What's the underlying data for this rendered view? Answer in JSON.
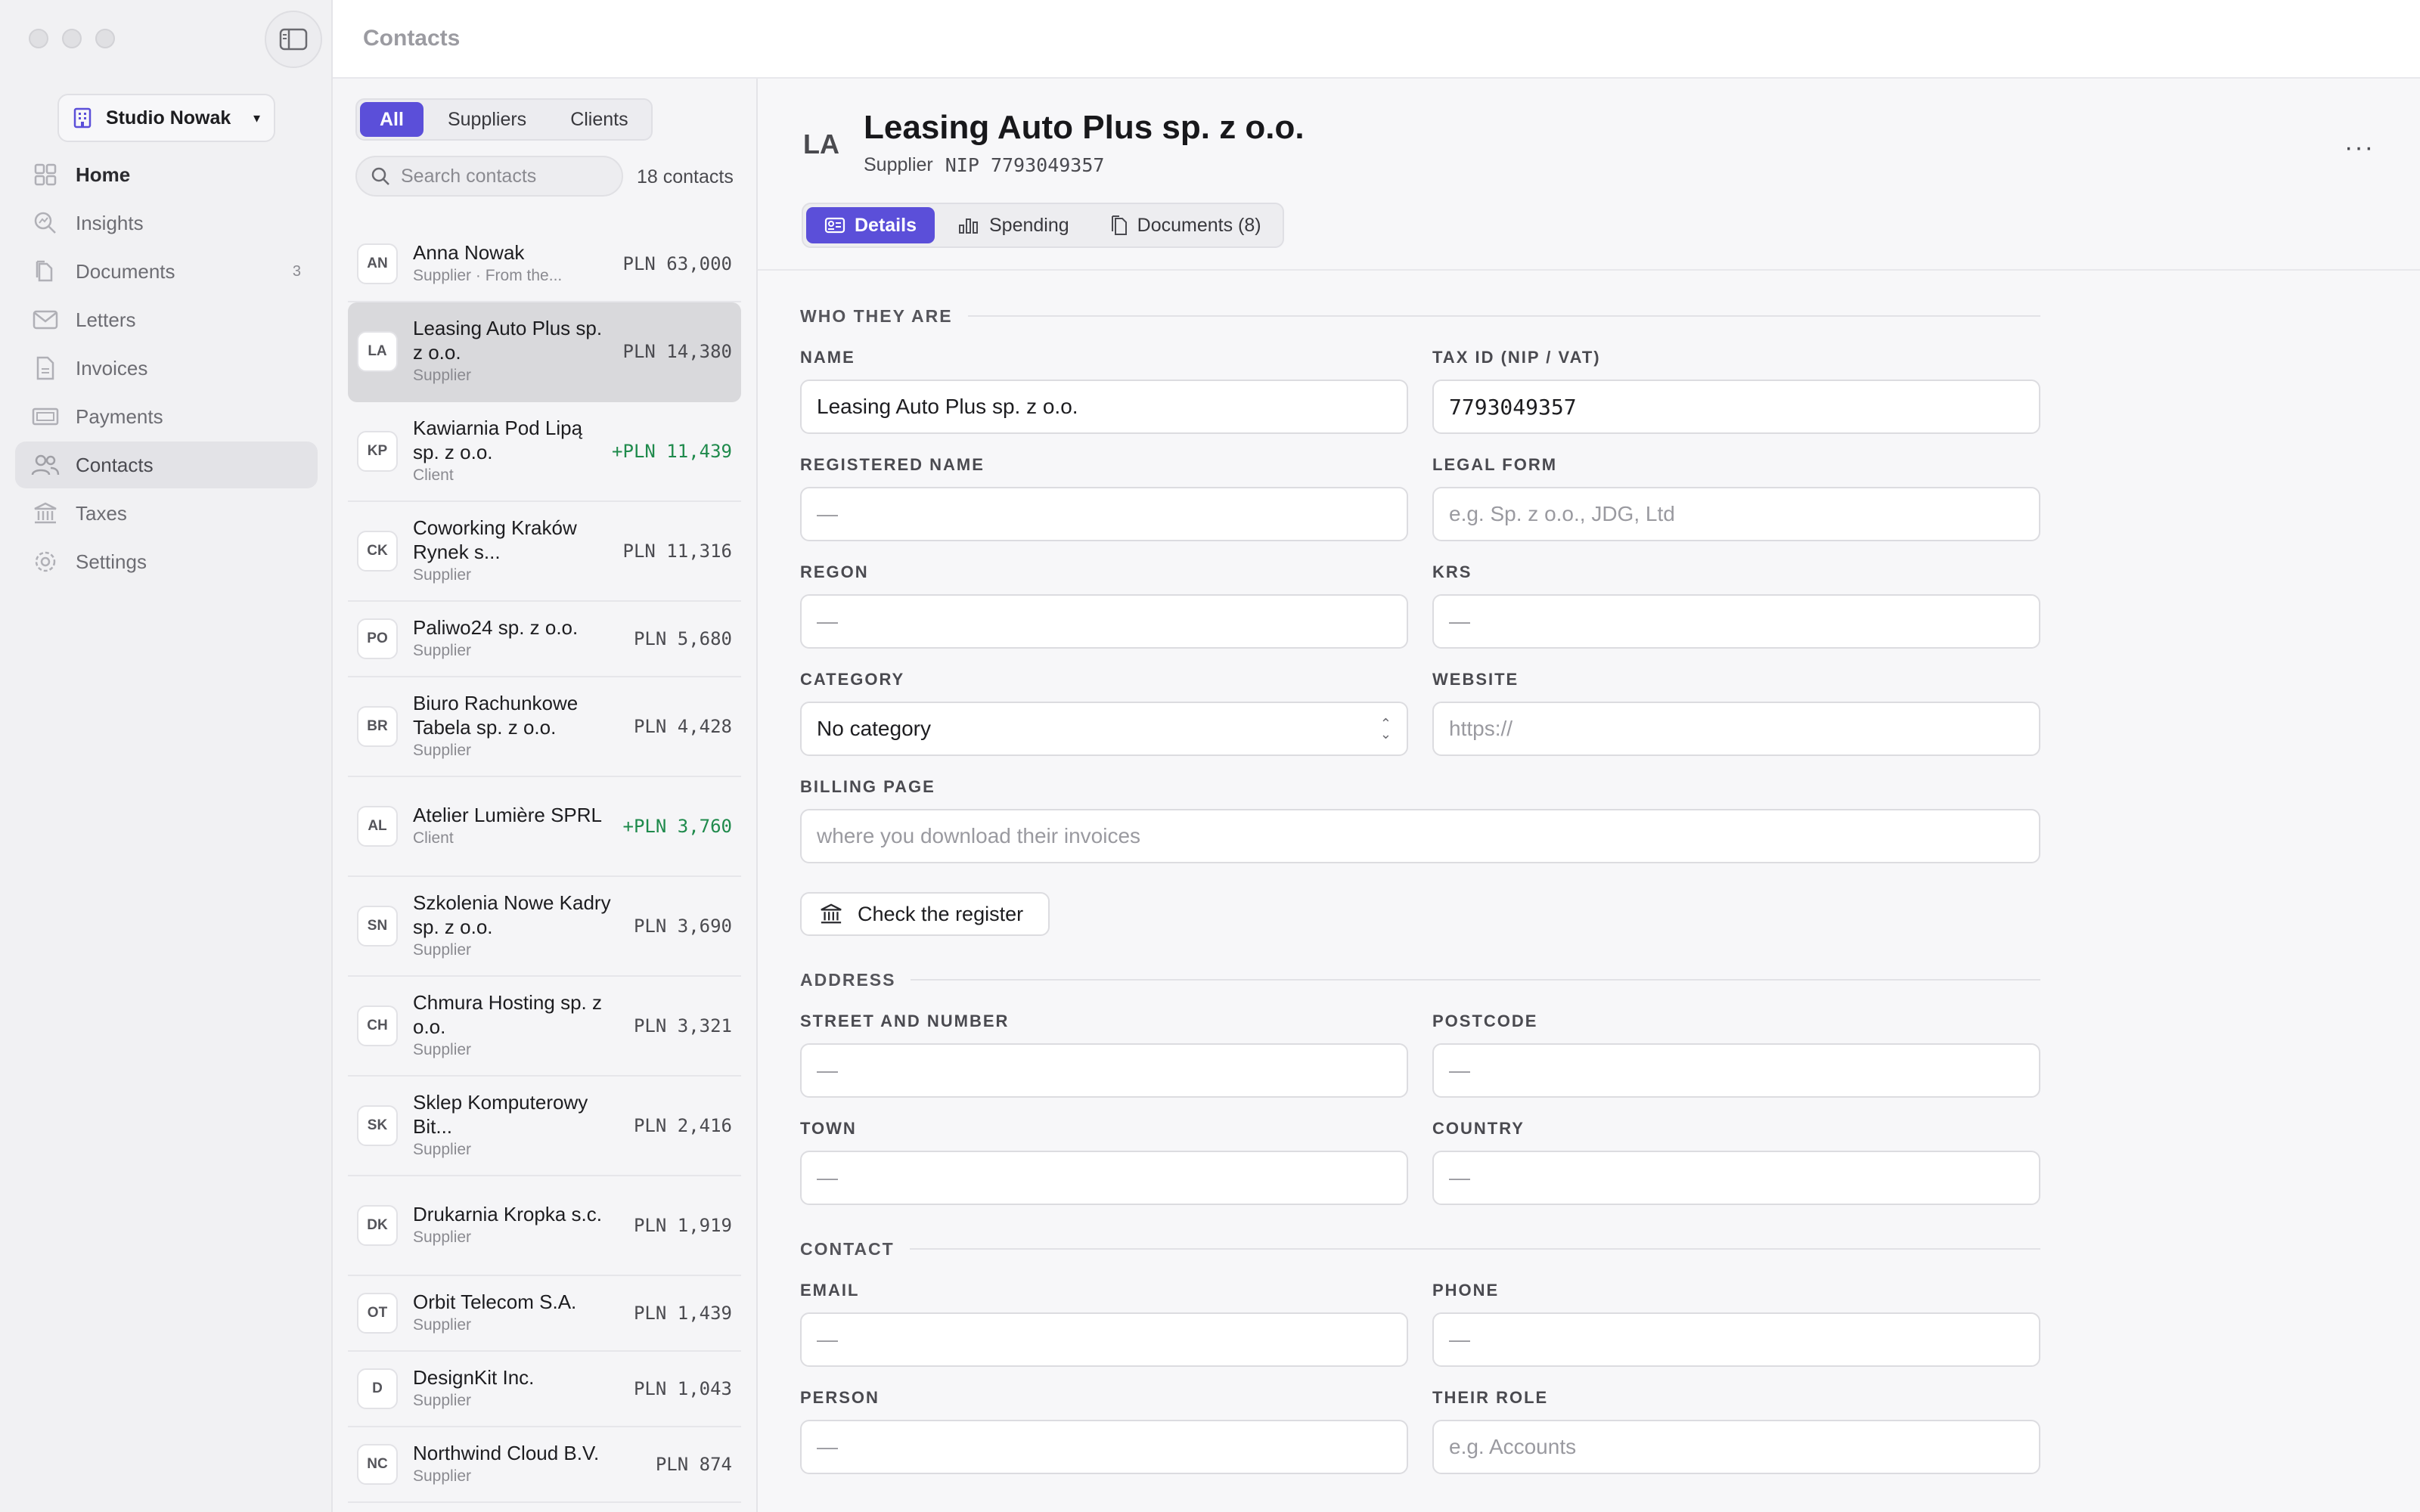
{
  "window": {
    "title": "Contacts"
  },
  "org": {
    "name": "Studio Nowak"
  },
  "nav": [
    {
      "id": "home",
      "label": "Home",
      "icon": "grid-icon"
    },
    {
      "id": "insights",
      "label": "Insights",
      "icon": "insights-icon"
    },
    {
      "id": "documents",
      "label": "Documents",
      "icon": "documents-icon",
      "badge": "3"
    },
    {
      "id": "letters",
      "label": "Letters",
      "icon": "envelope-icon"
    },
    {
      "id": "invoices",
      "label": "Invoices",
      "icon": "invoice-icon"
    },
    {
      "id": "payments",
      "label": "Payments",
      "icon": "payments-icon"
    },
    {
      "id": "contacts",
      "label": "Contacts",
      "icon": "people-icon"
    },
    {
      "id": "taxes",
      "label": "Taxes",
      "icon": "bank-icon"
    },
    {
      "id": "settings",
      "label": "Settings",
      "icon": "gear-icon"
    }
  ],
  "list": {
    "filters": [
      "All",
      "Suppliers",
      "Clients"
    ],
    "search_placeholder": "Search contacts",
    "count": "18 contacts",
    "contacts": [
      {
        "initials": "AN",
        "name": "Anna Nowak",
        "sub": "Supplier · From the...",
        "amount": "PLN 63,000"
      },
      {
        "initials": "LA",
        "name": "Leasing Auto Plus sp. z o.o.",
        "sub": "Supplier",
        "amount": "PLN 14,380"
      },
      {
        "initials": "KP",
        "name": "Kawiarnia Pod Lipą sp. z o.o.",
        "sub": "Client",
        "amount": "+PLN 11,439"
      },
      {
        "initials": "CK",
        "name": "Coworking Kraków Rynek s...",
        "sub": "Supplier",
        "amount": "PLN 11,316"
      },
      {
        "initials": "PO",
        "name": "Paliwo24 sp. z o.o.",
        "sub": "Supplier",
        "amount": "PLN 5,680"
      },
      {
        "initials": "BR",
        "name": "Biuro Rachunkowe Tabela sp. z o.o.",
        "sub": "Supplier",
        "amount": "PLN 4,428"
      },
      {
        "initials": "AL",
        "name": "Atelier Lumière SPRL",
        "sub": "Client",
        "amount": "+PLN 3,760"
      },
      {
        "initials": "SN",
        "name": "Szkolenia Nowe Kadry sp. z o.o.",
        "sub": "Supplier",
        "amount": "PLN 3,690"
      },
      {
        "initials": "CH",
        "name": "Chmura Hosting sp. z o.o.",
        "sub": "Supplier",
        "amount": "PLN 3,321"
      },
      {
        "initials": "SK",
        "name": "Sklep Komputerowy Bit...",
        "sub": "Supplier",
        "amount": "PLN 2,416"
      },
      {
        "initials": "DK",
        "name": "Drukarnia Kropka s.c.",
        "sub": "Supplier",
        "amount": "PLN 1,919"
      },
      {
        "initials": "OT",
        "name": "Orbit Telecom S.A.",
        "sub": "Supplier",
        "amount": "PLN 1,439"
      },
      {
        "initials": "D",
        "name": "DesignKit Inc.",
        "sub": "Supplier",
        "amount": "PLN 1,043"
      },
      {
        "initials": "NC",
        "name": "Northwind Cloud B.V.",
        "sub": "Supplier",
        "amount": "PLN 874"
      }
    ]
  },
  "detail": {
    "initials": "LA",
    "name": "Leasing Auto Plus sp. z o.o.",
    "type": "Supplier",
    "nip": "NIP 7793049357",
    "more": "···",
    "tabs": [
      {
        "label": "Details",
        "icon": "id-card-icon"
      },
      {
        "label": "Spending",
        "icon": "bar-chart-icon"
      },
      {
        "label": "Documents (8)",
        "icon": "documents-icon"
      }
    ],
    "sections": {
      "who": "WHO THEY ARE",
      "address": "ADDRESS",
      "contact": "CONTACT"
    },
    "fields": {
      "name": {
        "label": "NAME",
        "value": "Leasing Auto Plus sp. z o.o."
      },
      "tax_id": {
        "label": "TAX ID (NIP / VAT)",
        "value": "7793049357"
      },
      "registered_name": {
        "label": "REGISTERED NAME",
        "value": "—"
      },
      "legal_form": {
        "label": "LEGAL FORM",
        "placeholder": "e.g. Sp. z o.o., JDG, Ltd"
      },
      "regon": {
        "label": "REGON",
        "value": "—"
      },
      "krs": {
        "label": "KRS",
        "value": "—"
      },
      "category": {
        "label": "CATEGORY",
        "value": "No category"
      },
      "website": {
        "label": "WEBSITE",
        "placeholder": "https://"
      },
      "billing_page": {
        "label": "BILLING PAGE",
        "placeholder": "where you download their invoices"
      },
      "street": {
        "label": "STREET AND NUMBER",
        "value": "—"
      },
      "postcode": {
        "label": "POSTCODE",
        "value": "—"
      },
      "town": {
        "label": "TOWN",
        "value": "—"
      },
      "country": {
        "label": "COUNTRY",
        "value": "—"
      },
      "email": {
        "label": "EMAIL",
        "value": "—"
      },
      "phone": {
        "label": "PHONE",
        "value": "—"
      },
      "person": {
        "label": "PERSON",
        "value": "—"
      },
      "their_role": {
        "label": "THEIR ROLE",
        "placeholder": "e.g. Accounts"
      }
    },
    "check_register": "Check the register"
  },
  "colors": {
    "accent": "#5b4fd9",
    "positive": "#1f8a4c"
  }
}
